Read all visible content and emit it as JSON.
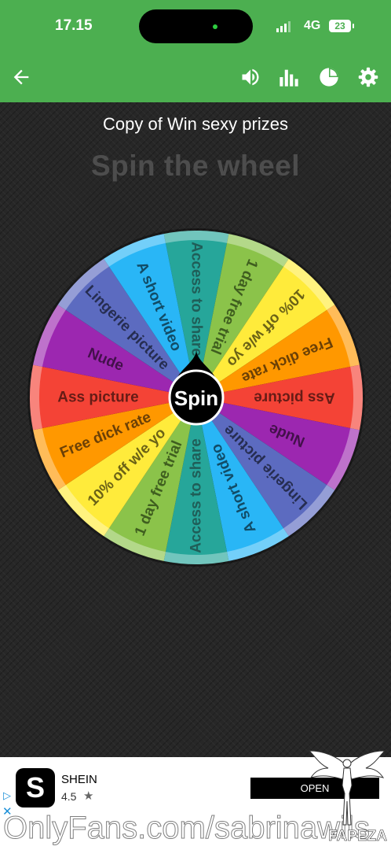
{
  "status_bar": {
    "time": "17.15",
    "network": "4G",
    "battery": "23"
  },
  "app_bar": {
    "icons": [
      "back-arrow-icon",
      "volume-icon",
      "bar-chart-icon",
      "pie-chart-icon",
      "gear-icon"
    ]
  },
  "page": {
    "subtitle": "Copy of Win sexy prizes",
    "headline": "Spin the wheel"
  },
  "wheel": {
    "center_label": "Spin",
    "segments": [
      {
        "label": "Access to share",
        "color": "#26a69a",
        "text_color": "#1f5e58"
      },
      {
        "label": "1 day free trial",
        "color": "#8bc34a",
        "text_color": "#3f5e1f"
      },
      {
        "label": "10% off w/e yo",
        "color": "#ffeb3b",
        "text_color": "#6b6216"
      },
      {
        "label": "Free dick rate",
        "color": "#ff9800",
        "text_color": "#6b4006"
      },
      {
        "label": "Ass picture",
        "color": "#f44336",
        "text_color": "#661c16"
      },
      {
        "label": "Nude",
        "color": "#9c27b0",
        "text_color": "#43104b"
      },
      {
        "label": "Lingerie picture",
        "color": "#5c6bc0",
        "text_color": "#262d51"
      },
      {
        "label": "A short video",
        "color": "#29b6f6",
        "text_color": "#114c67"
      },
      {
        "label": "Access to share",
        "color": "#26a69a",
        "text_color": "#1f5e58"
      },
      {
        "label": "1 day free trial",
        "color": "#8bc34a",
        "text_color": "#3f5e1f"
      },
      {
        "label": "10% off w/e yo",
        "color": "#ffeb3b",
        "text_color": "#6b6216"
      },
      {
        "label": "Free dick rate",
        "color": "#ff9800",
        "text_color": "#6b4006"
      },
      {
        "label": "Ass picture",
        "color": "#f44336",
        "text_color": "#661c16"
      },
      {
        "label": "Nude",
        "color": "#9c27b0",
        "text_color": "#43104b"
      },
      {
        "label": "Lingerie picture",
        "color": "#5c6bc0",
        "text_color": "#262d51"
      },
      {
        "label": "A short video",
        "color": "#29b6f6",
        "text_color": "#114c67"
      }
    ]
  },
  "ad": {
    "logo_letter": "S",
    "name": "SHEIN",
    "rating": "4.5",
    "star": "★",
    "cta": "OPEN",
    "adchoice": "▷",
    "close": "✕"
  },
  "watermark": {
    "text": "OnlyFans.com/sabrinawils",
    "logo_text": "FAPEZA"
  }
}
